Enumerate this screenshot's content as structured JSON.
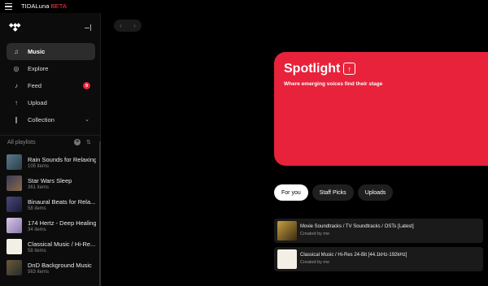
{
  "app": {
    "name": "TIDALuna",
    "beta": "BETA"
  },
  "sidebar": {
    "nav": [
      {
        "label": "Music",
        "icon": "music-note-icon",
        "active": true
      },
      {
        "label": "Explore",
        "icon": "compass-icon"
      },
      {
        "label": "Feed",
        "icon": "bell-icon",
        "badge": "9"
      },
      {
        "label": "Upload",
        "icon": "upload-arrow-icon"
      },
      {
        "label": "Collection",
        "icon": "collection-icon",
        "has_chevron": true
      }
    ],
    "playlists_header": "All playlists",
    "playlists": [
      {
        "name": "Rain Sounds for Relaxing",
        "count": "105 items"
      },
      {
        "name": "Star Wars Sleep",
        "count": "361 items"
      },
      {
        "name": "Binaural Beats for Rela...",
        "count": "58 items"
      },
      {
        "name": "174 Hertz - Deep Healing",
        "count": "34 items"
      },
      {
        "name": "Classical Music / Hi-Re...",
        "count": "58 items"
      },
      {
        "name": "DnD Background Music",
        "count": "563 items"
      }
    ]
  },
  "spotlight": {
    "title": "Spotlight",
    "subtitle": "Where emerging voices find their stage",
    "color": "#e8223b"
  },
  "tabs": [
    "For you",
    "Staff Picks",
    "Uploads"
  ],
  "rows": [
    {
      "title": "Movie Soundtracks / TV Soundtracks / OSTs [Latest]",
      "subtitle": "Created by me"
    },
    {
      "title": "Classical Music / Hi-Res 24-Bit [44.1kHz-192kHz]",
      "subtitle": "Created by me"
    }
  ]
}
